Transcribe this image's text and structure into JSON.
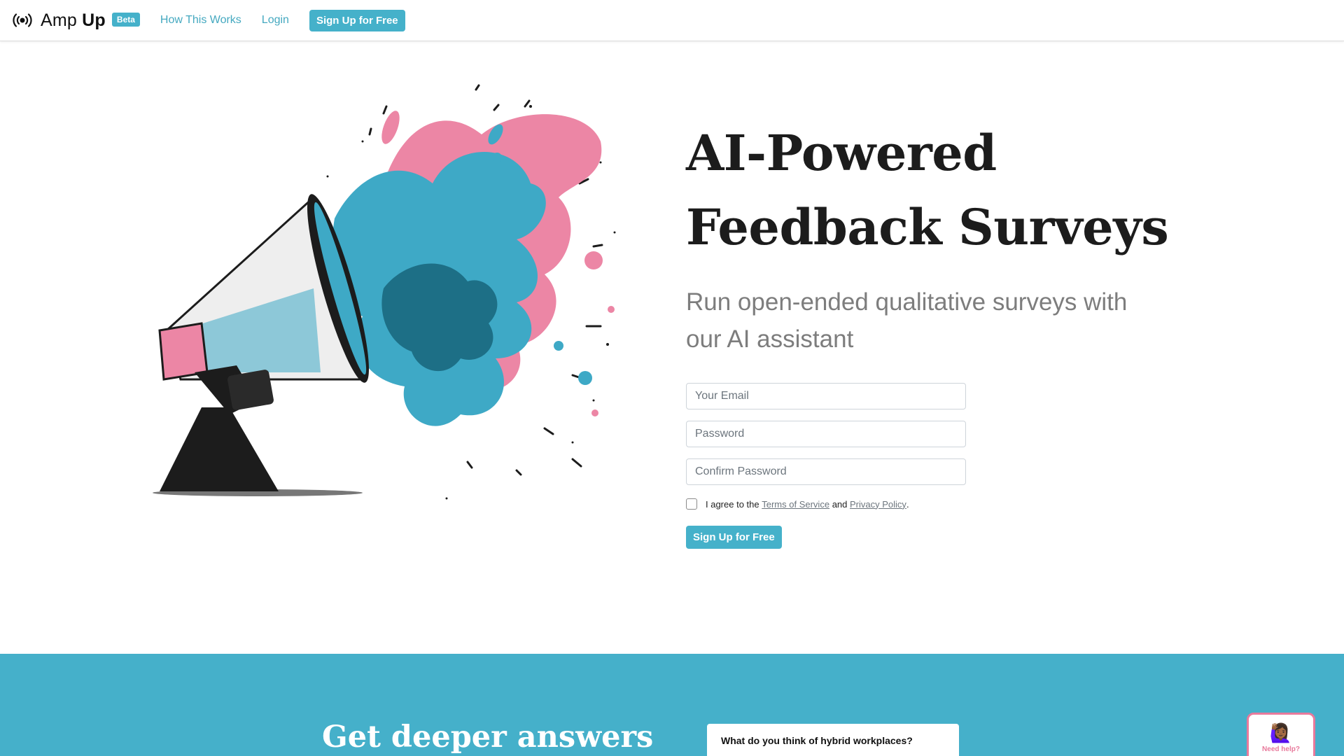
{
  "navbar": {
    "brand_first": "Amp",
    "brand_second": "Up",
    "brand_icon": "broadcast-icon",
    "beta": "Beta",
    "links": [
      "How This Works",
      "Login"
    ],
    "signup_label": "Sign Up for Free"
  },
  "hero": {
    "title_line1": "AI-Powered",
    "title_line2": "Feedback Surveys",
    "subtitle": "Run open-ended qualitative surveys with our AI assistant",
    "image": "megaphone-illustration",
    "form": {
      "email_placeholder": "Your Email",
      "password_placeholder": "Password",
      "confirm_placeholder": "Confirm Password",
      "terms_prefix": "I agree to the",
      "terms_link": "Terms of Service",
      "terms_and": "and",
      "privacy_link": "Privacy Policy",
      "terms_suffix": ".",
      "submit_label": "Sign Up for Free"
    }
  },
  "section2": {
    "title": "Get deeper answers",
    "card_question": "What do you think of hybrid workplaces?"
  },
  "help": {
    "emoji": "🙋🏾‍♀️",
    "label": "Need help?"
  },
  "colors": {
    "accent": "#45b1ca",
    "pink": "#e87a9c",
    "teal_dark": "#2b8fa8"
  }
}
